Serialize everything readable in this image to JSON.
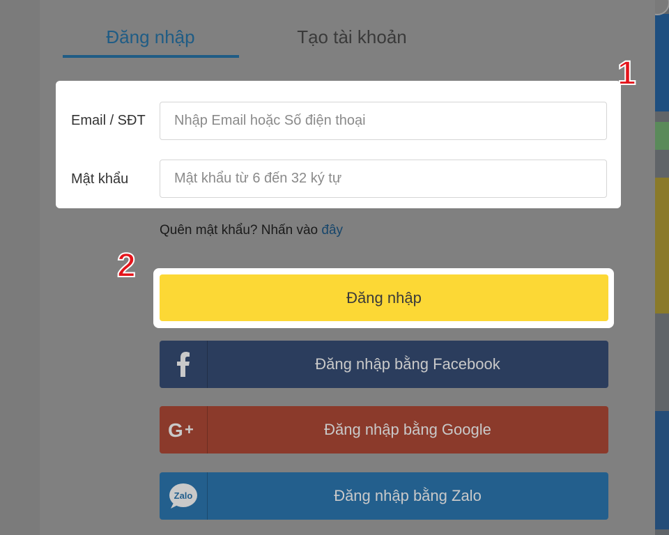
{
  "tabs": {
    "login": "Đăng nhập",
    "register": "Tạo tài khoản"
  },
  "form": {
    "email_label": "Email / SĐT",
    "email_placeholder": "Nhập Email hoặc Số điện thoại",
    "password_label": "Mật khẩu",
    "password_placeholder": "Mật khẩu từ 6 đến 32 ký tự"
  },
  "forgot": {
    "text": "Quên mật khẩu? Nhấn vào ",
    "link": "đây"
  },
  "annotations": {
    "badge_1": "1",
    "badge_2": "2"
  },
  "buttons": {
    "login": "Đăng nhập",
    "facebook": "Đăng nhập bằng Facebook",
    "google": "Đăng nhập bằng Google",
    "zalo": "Đăng nhập bằng Zalo"
  },
  "icons": {
    "facebook": "facebook-icon",
    "google": "google-plus-icon",
    "zalo": "zalo-icon"
  },
  "colors": {
    "accent": "#1f5c85",
    "login_button": "#fcd835",
    "facebook": "#2b3d5d",
    "google": "#8b3a2b",
    "zalo": "#235f8d",
    "badge": "#e3141b"
  }
}
